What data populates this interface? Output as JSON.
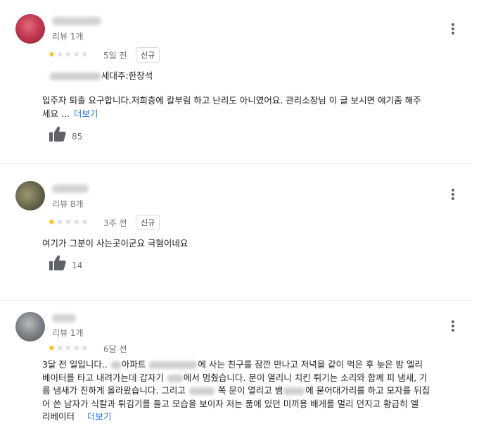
{
  "reviews": [
    {
      "review_count": "리뷰 1개",
      "rating": 1,
      "max_rating": 5,
      "date": "5일 전",
      "badge": "신규",
      "owner_line": "세대주:한창석",
      "text_line1": "입주자 퇴출 요구합니다.저희층에 칼부림 하고 난리도 아니였어요. 관리소장님 이 글 보시면 얘기좀 해주",
      "text_line2": "세요 ...",
      "more_label": "더보기",
      "likes": "85",
      "avatar_color": "#c43a52"
    },
    {
      "review_count": "리뷰 8개",
      "rating": 1,
      "max_rating": 5,
      "date": "3주 전",
      "badge": "신규",
      "text_line1": "여기가 그분이 사는곳이군요 극혐이네요",
      "likes": "14",
      "avatar_color": "#6b6a4e"
    },
    {
      "review_count": "리뷰 1개",
      "rating": 1,
      "max_rating": 5,
      "date": "6달 전",
      "p1_a": "3달 전 일입니다..",
      "p1_b": "아파트",
      "p1_c": "에 사는 친구를 잠깐 만나고 저녁을 같이 먹은 후 늦은 밤 엘리",
      "p2_a": "베이터를 타고 내려가는데 갑자기",
      "p2_b": "에서 멈췄습니다. 문이 열리니 치킨 튀기는 소리와 함께 피 냄새, 기",
      "p3_a": "름 냄새가 진하게 올라왔습니다. 그리고",
      "p3_b": "쪽 문이 열리고 뱀",
      "p3_c": "에 묻어대가리를 하고 모자를 뒤집",
      "p4": "어 쓴 남자가 식칼과 튀김기를 들고 모습을 보이자 저는 품에 있던 미끼용 배게를 멀리 던지고 황급히 엘",
      "p5": "리베이터",
      "more_label": "더보기",
      "avatar_color": "#7d8185"
    }
  ],
  "colors": {
    "star_on": "#fbbc04",
    "star_off": "#dadce0",
    "link": "#1a73e8"
  },
  "icons": {
    "like": "thumbs-up-icon",
    "menu": "more-vert-icon"
  }
}
